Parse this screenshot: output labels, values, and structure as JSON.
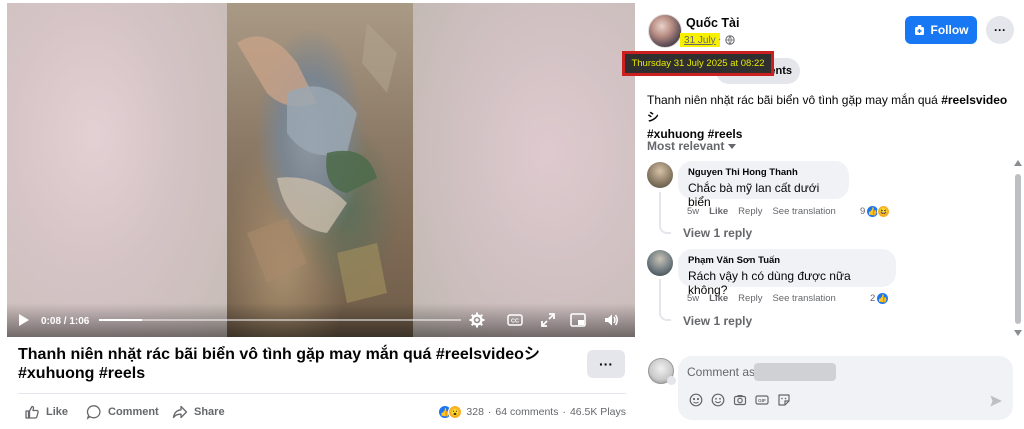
{
  "video": {
    "timecode": "0:08 / 1:06",
    "progress_fraction": 0.12
  },
  "post": {
    "title_line1": "Thanh niên nhặt rác bãi biển vô tình gặp may mắn quá #reelsvideoシ",
    "title_line2": "#xuhuong #reels",
    "more_label": "···",
    "actions": {
      "like": "Like",
      "comment": "Comment",
      "share": "Share"
    },
    "stats": {
      "reactions": "328",
      "comments": "64 comments",
      "plays": "46.5K Plays",
      "separator": "·"
    }
  },
  "header": {
    "author": "Quốc Tài",
    "date": "31 July",
    "separator": "·",
    "follow_label": "Follow",
    "more_label": "···",
    "tooltip": "Thursday 31 July 2025 at 08:22",
    "pill_label": "Comments"
  },
  "caption": {
    "text": "Thanh niên nhặt rác bãi biển vô tình gặp may mắn quá ",
    "hashtag1": "#reelsvideoシ",
    "hashtag2": "#xuhuong",
    "hashtag3": "#reels"
  },
  "sort": {
    "label": "Most relevant"
  },
  "comments": [
    {
      "name": "Nguyen Thi Hong Thanh",
      "text": "Chắc bà mỹ lan cất dưới biển",
      "time": "5w",
      "like": "Like",
      "reply": "Reply",
      "translate": "See translation",
      "reaction_count": "9",
      "view_replies": "View 1 reply"
    },
    {
      "name": "Phạm Văn Sơn Tuấn",
      "text": "Rách vậy h có dùng được nữa không?",
      "time": "5w",
      "like": "Like",
      "reply": "Reply",
      "translate": "See translation",
      "reaction_count": "2",
      "view_replies": "View 1 reply"
    }
  ],
  "composer": {
    "placeholder": "Comment as"
  },
  "colors": {
    "accent": "#1877f2",
    "highlight": "#f7f000",
    "tooltip_border": "#cc1f1f"
  }
}
